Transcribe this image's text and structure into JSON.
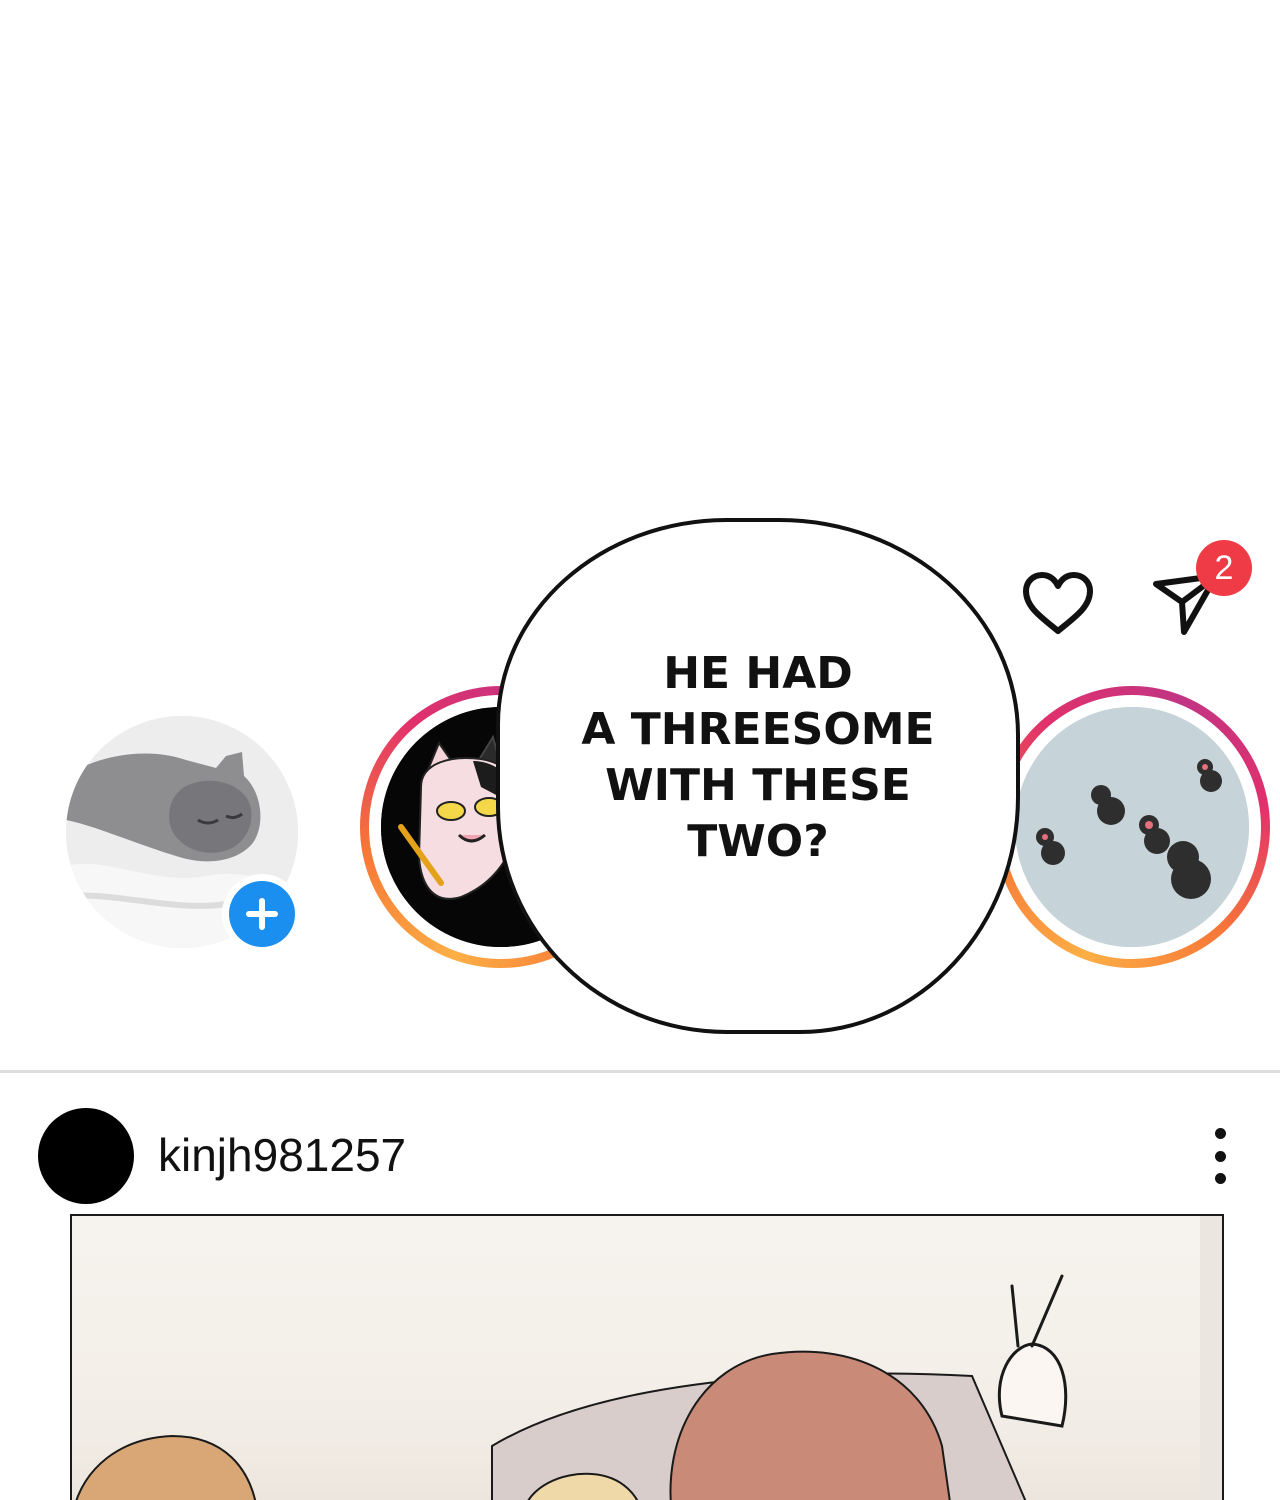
{
  "header": {
    "heart_icon": "heart-icon",
    "send_icon": "paper-plane-icon",
    "notification_count": "2",
    "badge_color": "#ef3b46"
  },
  "stories": [
    {
      "type": "own",
      "image": "sleeping-gray-cat",
      "add_icon": "plus-icon",
      "add_color": "#1a8ff0"
    },
    {
      "type": "unseen",
      "image": "cartoon-cat-character"
    },
    {
      "type": "unseen",
      "image": "cartoon-ants"
    }
  ],
  "speech_bubble": {
    "text": "HE HAD\nA THREESOME\nWITH THESE\nTWO?"
  },
  "post": {
    "username": "kinjh981257",
    "more_icon": "more-vertical-icon",
    "image": "illustration-people-on-pillows-peace-sign"
  }
}
